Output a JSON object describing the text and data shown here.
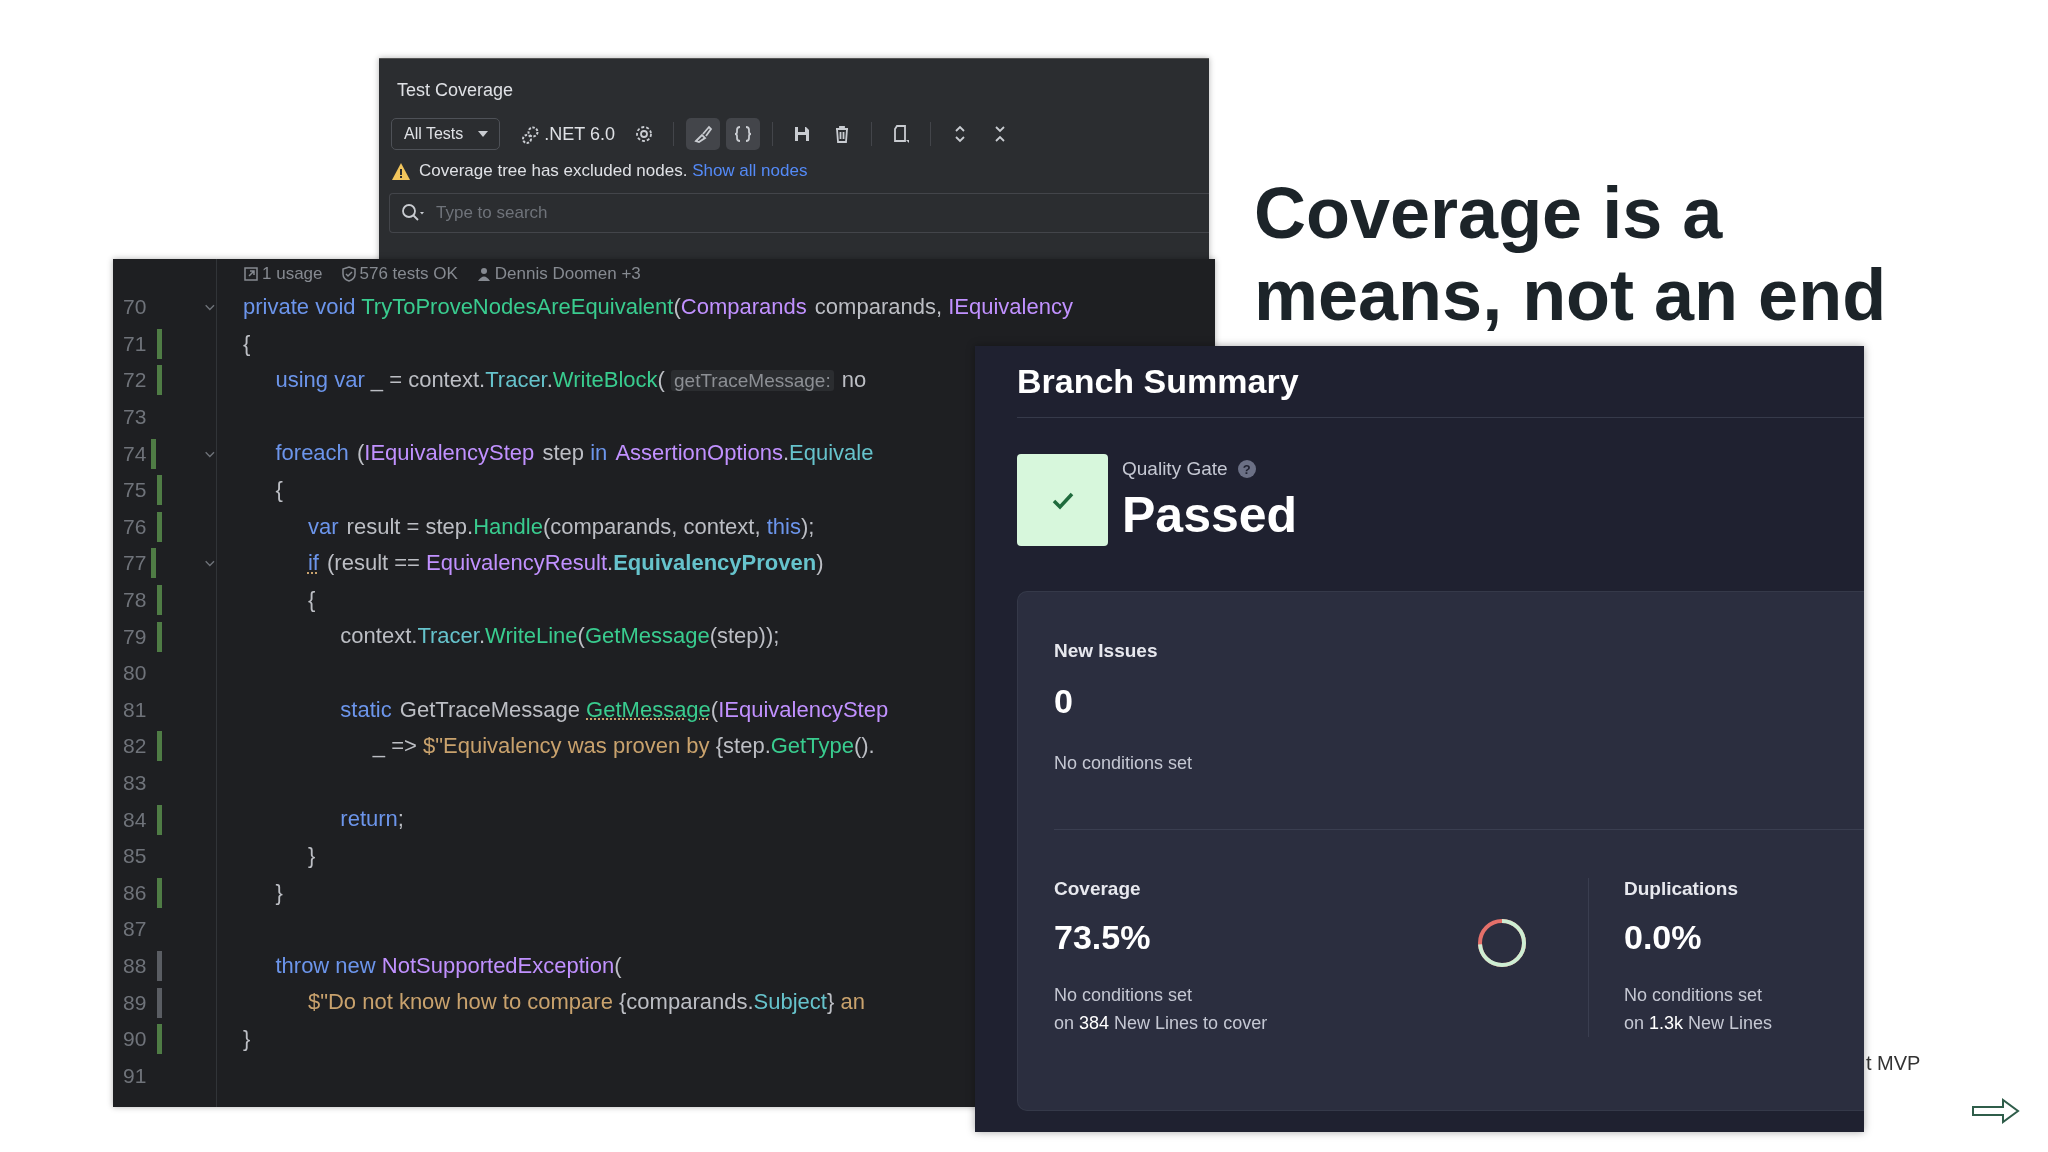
{
  "slide": {
    "title": "Coverage is a means, not an end",
    "footer": "t MVP"
  },
  "test_coverage": {
    "title": "Test Coverage",
    "scope": "All Tests",
    "framework": ".NET 6.0",
    "toggles": [
      {
        "selected": true
      },
      {
        "selected": true
      }
    ],
    "warning": "Coverage tree has excluded nodes.",
    "link": "Show all nodes",
    "search": {
      "placeholder": "Type to search"
    }
  },
  "editor": {
    "lens": [
      "1 usage",
      "576 tests OK",
      "Dennis Doomen +3"
    ],
    "lines": [
      {
        "number": "70",
        "fold": true,
        "tokens": [
          {
            "kind": "keyword",
            "text": "private void "
          },
          {
            "kind": "method",
            "text": "TryToProveNodesAreEquivalent"
          },
          {
            "kind": "plain",
            "text": "("
          },
          {
            "kind": "type",
            "text": "Comparands"
          },
          {
            "kind": "plain",
            "text": " comparands, "
          },
          {
            "kind": "type",
            "text": "IEquivalency"
          }
        ]
      },
      {
        "number": "71",
        "fold": false,
        "covered": true,
        "tokens": [
          {
            "kind": "plain",
            "text": "{"
          }
        ]
      },
      {
        "number": "72",
        "fold": false,
        "covered": true,
        "tokens": [
          {
            "kind": "keyword",
            "text": "    using var "
          },
          {
            "kind": "plain",
            "text": "_ = context."
          },
          {
            "kind": "field",
            "text": "Tracer"
          },
          {
            "kind": "plain",
            "text": "."
          },
          {
            "kind": "method",
            "text": "WriteBlock"
          },
          {
            "kind": "plain",
            "text": "( "
          },
          {
            "kind": "hint",
            "text": "getTraceMessage:"
          },
          {
            "kind": "plain",
            "text": " no"
          }
        ]
      },
      {
        "number": "73",
        "fold": false
      },
      {
        "number": "74",
        "fold": true,
        "covered": true,
        "tokens": [
          {
            "kind": "keyword",
            "text": "    foreach"
          },
          {
            "kind": "plain",
            "text": " ("
          },
          {
            "kind": "type",
            "text": "IEquivalencyStep"
          },
          {
            "kind": "plain",
            "text": " step "
          },
          {
            "kind": "keyword",
            "text": "in"
          },
          {
            "kind": "type",
            "text": " AssertionOptions"
          },
          {
            "kind": "plain",
            "text": "."
          },
          {
            "kind": "field",
            "text": "Equivale"
          }
        ]
      },
      {
        "number": "75",
        "fold": false,
        "covered": true,
        "tokens": [
          {
            "kind": "plain",
            "text": "    {"
          }
        ]
      },
      {
        "number": "76",
        "fold": false,
        "covered": true,
        "tokens": [
          {
            "kind": "keyword",
            "text": "        var"
          },
          {
            "kind": "plain",
            "text": " result = step."
          },
          {
            "kind": "method",
            "text": "Handle"
          },
          {
            "kind": "plain",
            "text": "(comparands, context, "
          },
          {
            "kind": "keyword",
            "text": "this"
          },
          {
            "kind": "plain",
            "text": ");"
          }
        ]
      },
      {
        "number": "77",
        "fold": true,
        "covered": true,
        "tokens": [
          {
            "kind": "keyword-warn",
            "text": "        if"
          },
          {
            "kind": "plain",
            "text": " (result == "
          },
          {
            "kind": "type",
            "text": "EquivalencyResult"
          },
          {
            "kind": "plain",
            "text": "."
          },
          {
            "kind": "field-strong",
            "text": "EquivalencyProven"
          },
          {
            "kind": "plain",
            "text": ")"
          }
        ]
      },
      {
        "number": "78",
        "fold": false,
        "covered": true,
        "tokens": [
          {
            "kind": "plain",
            "text": "        {"
          }
        ]
      },
      {
        "number": "79",
        "fold": false,
        "covered": true,
        "tokens": [
          {
            "kind": "plain",
            "text": "            context."
          },
          {
            "kind": "field",
            "text": "Tracer"
          },
          {
            "kind": "plain",
            "text": "."
          },
          {
            "kind": "method",
            "text": "WriteLine"
          },
          {
            "kind": "plain",
            "text": "("
          },
          {
            "kind": "method",
            "text": "GetMessage"
          },
          {
            "kind": "plain",
            "text": "(step));"
          }
        ]
      },
      {
        "number": "80",
        "fold": false
      },
      {
        "number": "81",
        "fold": false,
        "tokens": [
          {
            "kind": "keyword",
            "text": "            static"
          },
          {
            "kind": "plain",
            "text": " GetTraceMessage "
          },
          {
            "kind": "method-warn",
            "text": "GetMessage"
          },
          {
            "kind": "plain",
            "text": "("
          },
          {
            "kind": "type",
            "text": "IEquivalencyStep"
          }
        ]
      },
      {
        "number": "82",
        "fold": false,
        "covered": true,
        "tokens": [
          {
            "kind": "plain",
            "text": "                _ => "
          },
          {
            "kind": "string",
            "text": "$\"Equivalency was proven by "
          },
          {
            "kind": "plain",
            "text": "{step."
          },
          {
            "kind": "method",
            "text": "GetType"
          },
          {
            "kind": "plain",
            "text": "()."
          }
        ]
      },
      {
        "number": "83",
        "fold": false
      },
      {
        "number": "84",
        "fold": false,
        "covered": true,
        "tokens": [
          {
            "kind": "keyword",
            "text": "            return"
          },
          {
            "kind": "plain",
            "text": ";"
          }
        ]
      },
      {
        "number": "85",
        "fold": false,
        "tokens": [
          {
            "kind": "plain",
            "text": "        }"
          }
        ]
      },
      {
        "number": "86",
        "fold": false,
        "covered": true,
        "tokens": [
          {
            "kind": "plain",
            "text": "    }"
          }
        ]
      },
      {
        "number": "87",
        "fold": false
      },
      {
        "number": "88",
        "fold": false,
        "covered": false,
        "tokens": [
          {
            "kind": "keyword",
            "text": "    throw new "
          },
          {
            "kind": "type",
            "text": "NotSupportedException"
          },
          {
            "kind": "plain",
            "text": "("
          }
        ]
      },
      {
        "number": "89",
        "fold": false,
        "covered": false,
        "tokens": [
          {
            "kind": "string",
            "text": "        $\"Do not know how to compare "
          },
          {
            "kind": "plain",
            "text": "{comparands."
          },
          {
            "kind": "field",
            "text": "Subject"
          },
          {
            "kind": "plain",
            "text": "} "
          },
          {
            "kind": "string",
            "text": "an"
          }
        ]
      },
      {
        "number": "90",
        "fold": false,
        "covered": true,
        "tokens": [
          {
            "kind": "plain",
            "text": "}"
          }
        ]
      },
      {
        "number": "91",
        "fold": false
      }
    ]
  },
  "branch_summary": {
    "title": "Branch Summary",
    "quality_gate": {
      "label": "Quality Gate",
      "help": "?",
      "status": "Passed",
      "passed": true
    },
    "new_issues": {
      "label": "New Issues",
      "value": "0",
      "note": "No conditions set"
    },
    "metrics": [
      {
        "kind": "gauge",
        "label": "Coverage",
        "value": "73.5%",
        "note": "No conditions set",
        "detail": "on **384** New Lines to cover",
        "level": 0.735
      },
      {
        "kind": "plain",
        "label": "Duplications",
        "value": "0.0%",
        "note": "No conditions set",
        "detail": "on **1.3k** New Lines"
      }
    ]
  }
}
